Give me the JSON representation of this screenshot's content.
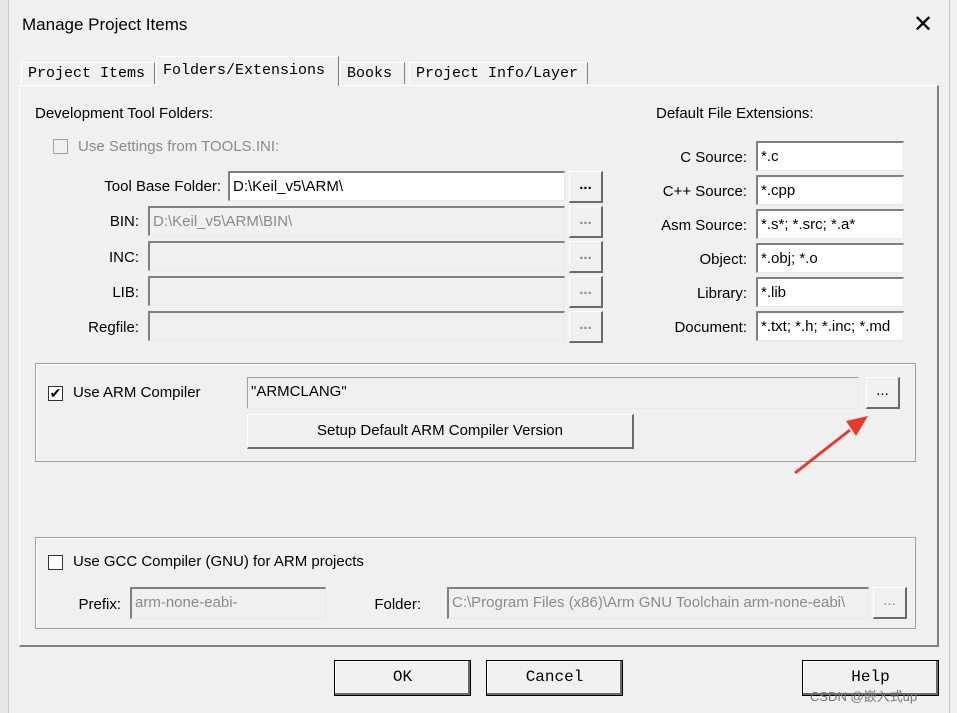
{
  "window": {
    "title": "Manage Project Items",
    "close_glyph": "✕"
  },
  "tabs": [
    {
      "label": "Project Items",
      "active": false
    },
    {
      "label": "Folders/Extensions",
      "active": true
    },
    {
      "label": "Books",
      "active": false
    },
    {
      "label": "Project Info/Layer",
      "active": false
    }
  ],
  "dev_folders": {
    "heading": "Development Tool Folders:",
    "use_tools_ini": {
      "label": "Use Settings from TOOLS.INI:",
      "checked": false,
      "enabled": false
    },
    "tool_base": {
      "label": "Tool Base Folder:",
      "value": "D:\\Keil_v5\\ARM\\"
    },
    "bin": {
      "label": "BIN:",
      "value": "D:\\Keil_v5\\ARM\\BIN\\"
    },
    "inc": {
      "label": "INC:",
      "value": ""
    },
    "lib": {
      "label": "LIB:",
      "value": ""
    },
    "regfile": {
      "label": "Regfile:",
      "value": ""
    },
    "browse_label": "..."
  },
  "extensions": {
    "heading": "Default File Extensions:",
    "c_source": {
      "label": "C Source:",
      "value": "*.c"
    },
    "cpp_source": {
      "label": "C++ Source:",
      "value": "*.cpp"
    },
    "asm_source": {
      "label": "Asm Source:",
      "value": "*.s*; *.src; *.a*"
    },
    "object": {
      "label": "Object:",
      "value": "*.obj; *.o"
    },
    "library": {
      "label": "Library:",
      "value": "*.lib"
    },
    "document": {
      "label": "Document:",
      "value": "*.txt; *.h; *.inc; *.md"
    }
  },
  "arm_compiler": {
    "checkbox_label": "Use ARM Compiler",
    "checked": true,
    "value": "\"ARMCLANG\"",
    "browse_label": "...",
    "setup_button": "Setup Default ARM Compiler Version"
  },
  "gcc_compiler": {
    "checkbox_label": "Use GCC Compiler (GNU) for ARM projects",
    "checked": false,
    "prefix_label": "Prefix:",
    "prefix_value": "arm-none-eabi-",
    "folder_label": "Folder:",
    "folder_value": "C:\\Program Files (x86)\\Arm GNU Toolchain arm-none-eabi\\",
    "browse_label": "..."
  },
  "buttons": {
    "ok": "OK",
    "cancel": "Cancel",
    "help": "Help"
  },
  "watermark": "CSDN @嵌入式up",
  "annotation_color": "#e8392f"
}
